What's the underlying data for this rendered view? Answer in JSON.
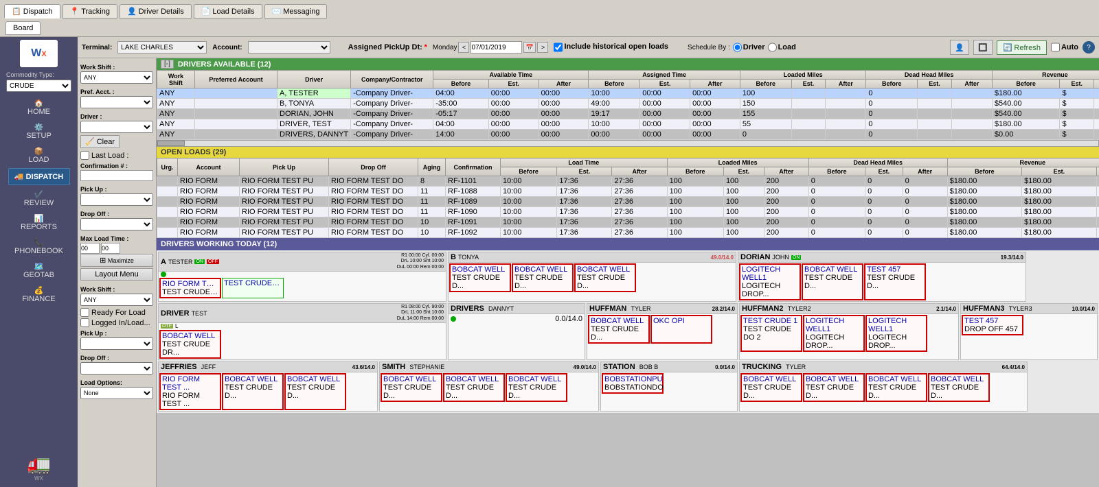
{
  "app": {
    "logo": "WX",
    "commodity_label": "Commodity Type:",
    "commodity_value": "CRUDE"
  },
  "tabs": [
    {
      "label": "Dispatch",
      "icon": "📋",
      "active": true
    },
    {
      "label": "Tracking",
      "icon": "📍",
      "active": false
    },
    {
      "label": "Driver Details",
      "icon": "👤",
      "active": false
    },
    {
      "label": "Load Details",
      "icon": "📄",
      "active": false
    },
    {
      "label": "Messaging",
      "icon": "✉️",
      "active": false
    }
  ],
  "board_tab": {
    "label": "Board",
    "active": true
  },
  "toolbar": {
    "terminal_label": "Terminal:",
    "terminal_value": "LAKE CHARLES",
    "account_label": "Account:",
    "assigned_pickup_label": "Assigned PickUp Dt:",
    "day_label": "Monday",
    "date_value": "07/01/2019",
    "include_historical": "Include historical open loads",
    "schedule_by_label": "Schedule By :",
    "schedule_driver": "Driver",
    "schedule_load": "Load",
    "refresh_label": "Refresh",
    "auto_label": "Auto"
  },
  "filter": {
    "work_shift_label": "Work Shift :",
    "work_shift_value": "ANY",
    "pref_acct_label": "Pref. Acct. :",
    "driver_label": "Driver :",
    "clear_label": "Clear",
    "last_load_label": "Last Load :",
    "confirmation_label": "Confirmation # :",
    "pickup_label": "Pick Up :",
    "dropoff_label": "Drop Off :",
    "max_load_label": "Max Load Time :",
    "max_load_value": "00 : 00",
    "ready_load_label": "Ready For Load",
    "logged_label": "Logged In/Load...",
    "pickup2_label": "Pick Up :",
    "dropoff2_label": "Drop Off :",
    "load_options_label": "Load Options:",
    "load_options_value": "None",
    "maximize_label": "⊞ Maximize",
    "layout_label": "Layout Menu",
    "work_shift2_label": "Work Shift :",
    "work_shift2_value": "ANY"
  },
  "drivers_available": {
    "header": "DRIVERS AVAILABLE (12)",
    "toggle": "[-]",
    "columns": {
      "work_shift": "Work Shift",
      "preferred_account": "Preferred Account",
      "driver": "Driver",
      "company": "Company/Contractor",
      "available_time": "Available Time",
      "assigned_time": "Assigned Time",
      "loaded_miles": "Loaded Miles",
      "dead_head": "Dead Head Miles",
      "revenue": "Revenue"
    },
    "sub_columns": [
      "Before",
      "Est.",
      "After",
      "Before",
      "Est.",
      "After",
      "Before",
      "Est.",
      "After",
      "Before",
      "Est.",
      "After",
      "Before",
      "Est.",
      "Af"
    ],
    "rows": [
      {
        "shift": "ANY",
        "pref_acct": "",
        "driver": "A, TESTER",
        "company": "-Company Driver-",
        "av_before": "04:00",
        "av_est": "00:00",
        "av_after": "00:00",
        "as_before": "10:00",
        "as_est": "00:00",
        "as_after": "00:00",
        "lm_before": "100",
        "lm_est": "",
        "lm_after": "",
        "dh_before": "0",
        "dh_est": "",
        "dh_after": "",
        "rev_before": "$180.00",
        "rev_est": "$",
        "selected": true
      },
      {
        "shift": "ANY",
        "pref_acct": "",
        "driver": "B, TONYA",
        "company": "-Company Driver-",
        "av_before": "-35:00",
        "av_est": "00:00",
        "av_after": "00:00",
        "as_before": "49:00",
        "as_est": "00:00",
        "as_after": "00:00",
        "lm_before": "150",
        "lm_est": "",
        "lm_after": "",
        "dh_before": "0",
        "dh_est": "",
        "dh_after": "",
        "rev_before": "$540.00",
        "rev_est": "$",
        "selected": false
      },
      {
        "shift": "ANY",
        "pref_acct": "",
        "driver": "DORIAN, JOHN",
        "company": "-Company Driver-",
        "av_before": "-05:17",
        "av_est": "00:00",
        "av_after": "00:00",
        "as_before": "19:17",
        "as_est": "00:00",
        "as_after": "00:00",
        "lm_before": "155",
        "lm_est": "",
        "lm_after": "",
        "dh_before": "0",
        "dh_est": "",
        "dh_after": "",
        "rev_before": "$540.00",
        "rev_est": "$",
        "selected": false
      },
      {
        "shift": "ANY",
        "pref_acct": "",
        "driver": "DRIVER, TEST",
        "company": "-Company Driver-",
        "av_before": "04:00",
        "av_est": "00:00",
        "av_after": "00:00",
        "as_before": "10:00",
        "as_est": "00:00",
        "as_after": "00:00",
        "lm_before": "55",
        "lm_est": "",
        "lm_after": "",
        "dh_before": "0",
        "dh_est": "",
        "dh_after": "",
        "rev_before": "$180.00",
        "rev_est": "$",
        "selected": false
      },
      {
        "shift": "ANY",
        "pref_acct": "",
        "driver": "DRIVERS, DANNYT",
        "company": "-Company Driver-",
        "av_before": "14:00",
        "av_est": "00:00",
        "av_after": "00:00",
        "as_before": "00:00",
        "as_est": "00:00",
        "as_after": "00:00",
        "lm_before": "0",
        "lm_est": "",
        "lm_after": "",
        "dh_before": "0",
        "dh_est": "",
        "dh_after": "",
        "rev_before": "$0.00",
        "rev_est": "$",
        "selected": false
      }
    ]
  },
  "open_loads": {
    "header": "OPEN LOADS (29)",
    "columns": {
      "urg": "Urg.",
      "account": "Account",
      "pickup": "Pick Up",
      "dropoff": "Drop Off",
      "aging": "Aging",
      "confirmation": "Confirmation",
      "load_time": "Load Time",
      "loaded_miles": "Loaded Miles",
      "dead_head": "Dead Head Miles",
      "revenue": "Revenue"
    },
    "sub_columns": [
      "Before",
      "Est.",
      "After",
      "Before",
      "Est.",
      "After",
      "Before",
      "Est.",
      "After",
      "Before",
      "Est.",
      "A"
    ],
    "rows": [
      {
        "urg": "",
        "account": "RIO FORM",
        "pickup": "RIO FORM TEST PU",
        "dropoff": "RIO FORM TEST DO",
        "aging": "8",
        "confirmation": "RF-1101",
        "lt_before": "10:00",
        "lt_est": "17:36",
        "lt_after": "27:36",
        "lm_before": "100",
        "lm_est": "100",
        "lm_after": "200",
        "dh_before": "0",
        "dh_est": "0",
        "dh_after": "0",
        "rev_before": "$180.00",
        "rev_est": "$180.00"
      },
      {
        "urg": "",
        "account": "RIO FORM",
        "pickup": "RIO FORM TEST PU",
        "dropoff": "RIO FORM TEST DO",
        "aging": "11",
        "confirmation": "RF-1088",
        "lt_before": "10:00",
        "lt_est": "17:36",
        "lt_after": "27:36",
        "lm_before": "100",
        "lm_est": "100",
        "lm_after": "200",
        "dh_before": "0",
        "dh_est": "0",
        "dh_after": "0",
        "rev_before": "$180.00",
        "rev_est": "$180.00"
      },
      {
        "urg": "",
        "account": "RIO FORM",
        "pickup": "RIO FORM TEST PU",
        "dropoff": "RIO FORM TEST DO",
        "aging": "11",
        "confirmation": "RF-1089",
        "lt_before": "10:00",
        "lt_est": "17:36",
        "lt_after": "27:36",
        "lm_before": "100",
        "lm_est": "100",
        "lm_after": "200",
        "dh_before": "0",
        "dh_est": "0",
        "dh_after": "0",
        "rev_before": "$180.00",
        "rev_est": "$180.00"
      },
      {
        "urg": "",
        "account": "RIO FORM",
        "pickup": "RIO FORM TEST PU",
        "dropoff": "RIO FORM TEST DO",
        "aging": "11",
        "confirmation": "RF-1090",
        "lt_before": "10:00",
        "lt_est": "17:36",
        "lt_after": "27:36",
        "lm_before": "100",
        "lm_est": "100",
        "lm_after": "200",
        "dh_before": "0",
        "dh_est": "0",
        "dh_after": "0",
        "rev_before": "$180.00",
        "rev_est": "$180.00"
      },
      {
        "urg": "",
        "account": "RIO FORM",
        "pickup": "RIO FORM TEST PU",
        "dropoff": "RIO FORM TEST DO",
        "aging": "10",
        "confirmation": "RF-1091",
        "lt_before": "10:00",
        "lt_est": "17:36",
        "lt_after": "27:36",
        "lm_before": "100",
        "lm_est": "100",
        "lm_after": "200",
        "dh_before": "0",
        "dh_est": "0",
        "dh_after": "0",
        "rev_before": "$180.00",
        "rev_est": "$180.00"
      },
      {
        "urg": "",
        "account": "RIO FORM",
        "pickup": "RIO FORM TEST PU",
        "dropoff": "RIO FORM TEST DO",
        "aging": "10",
        "confirmation": "RF-1092",
        "lt_before": "10:00",
        "lt_est": "17:36",
        "lt_after": "27:36",
        "lm_before": "100",
        "lm_est": "100",
        "lm_after": "200",
        "dh_before": "0",
        "dh_est": "0",
        "dh_after": "0",
        "rev_before": "$180.00",
        "rev_est": "$180.00"
      }
    ]
  },
  "drivers_working": {
    "header": "DRIVERS WORKING TODAY (12)",
    "drivers": [
      {
        "id": "A",
        "name": "TESTER",
        "status": "green",
        "badge_on": "ON",
        "badge_off": "OFF",
        "info": "R1  00:00 Cyl. 00:00\nDrL 10:00 Sht 10:00\nDuL 00:00 Rem 00:00",
        "miles": "",
        "loads": [
          {
            "title": "RIO FORM TEST ...",
            "sub": "TEST CRUDE DR...",
            "color": "red"
          },
          {
            "title": "TEST CRUDE DR...",
            "sub": "",
            "color": "green"
          }
        ]
      },
      {
        "id": "B",
        "name": "TONYA",
        "status": "yellow",
        "badge_on": "",
        "badge_off": "",
        "info": "49.0/14.0",
        "miles": "49.0/14.0",
        "loads": [
          {
            "title": "BOBCAT WELL TEST CRUDE D...",
            "sub": "",
            "color": "red"
          },
          {
            "title": "BOBCAT WELL TEST CRUDE D...",
            "sub": "",
            "color": "red"
          },
          {
            "title": "BOBCAT WELL TEST CRUDE D...",
            "sub": "",
            "color": "red"
          }
        ]
      },
      {
        "id": "DORIAN",
        "name": "JOHN",
        "status": "green",
        "info": "",
        "miles": "19.3/14.0",
        "loads": [
          {
            "title": "LOGITECH WELL1",
            "sub": "LOGITECH DROP...",
            "color": "red"
          },
          {
            "title": "BOBCAT WELL",
            "sub": "TEST CRUDE D...",
            "color": "red"
          },
          {
            "title": "TEST 457",
            "sub": "TEST CRUDE D...",
            "color": "red"
          }
        ]
      },
      {
        "id": "DRIVER",
        "name": "TEST",
        "status": "green",
        "info": "R1  08:00 Cyl. 90:00\nDrL 11:00 Sht 10:00\nDuL 14:00 Rem 00:00",
        "miles": "",
        "loads": [
          {
            "title": "BOBCAT WELL TEST CRUDE D...",
            "sub": "",
            "color": "red"
          }
        ]
      },
      {
        "id": "DRIVERS",
        "name": "DANNYT",
        "status": "green",
        "info": "",
        "miles": "0.0/14.0",
        "loads": []
      },
      {
        "id": "HUFFMAN",
        "name": "TYLER",
        "status": "green",
        "info": "",
        "miles": "28.2/14.0",
        "loads": [
          {
            "title": "BOBCAT WELL TEST CRUDE D...",
            "sub": "",
            "color": "red"
          },
          {
            "title": "OKC OPI",
            "sub": "",
            "color": "red"
          }
        ]
      },
      {
        "id": "HUFFMAN2",
        "name": "TYLER2",
        "status": "green",
        "info": "",
        "miles": "2.1/14.0",
        "loads": [
          {
            "title": "TEST CRUDE 1",
            "sub": "TEST CRUDE DO 2",
            "color": "red"
          },
          {
            "title": "LOGITECH WELL1",
            "sub": "LOGITECH DROP...",
            "color": "red"
          },
          {
            "title": "LOGITECH WELL1",
            "sub": "LOGITECH DROP...",
            "color": "red"
          }
        ]
      },
      {
        "id": "HUFFMAN3",
        "name": "TYLER3",
        "status": "green",
        "info": "",
        "miles": "10.0/14.0",
        "loads": [
          {
            "title": "TEST 457",
            "sub": "DROP OFF 457",
            "color": "red"
          }
        ]
      },
      {
        "id": "JEFFRIES",
        "name": "JEFF",
        "status": "green",
        "info": "",
        "miles": "43.6/14.0",
        "loads": [
          {
            "title": "RIO FORM TEST ...",
            "sub": "RIO FORM TEST ...",
            "color": "red"
          },
          {
            "title": "BOBCAT WELL TEST CRUDE D...",
            "sub": "",
            "color": "red"
          },
          {
            "title": "BOBCAT WELL TEST CRUDE D...",
            "sub": "",
            "color": "red"
          }
        ]
      },
      {
        "id": "SMITH",
        "name": "STEPHANIE",
        "status": "green",
        "info": "",
        "miles": "49.0/14.0",
        "loads": [
          {
            "title": "BOBCAT WELL TEST CRUDE D...",
            "sub": "",
            "color": "red"
          },
          {
            "title": "BOBCAT WELL TEST CRUDE D...",
            "sub": "",
            "color": "red"
          },
          {
            "title": "BOBCAT WELL TEST CRUDE D...",
            "sub": "",
            "color": "red"
          }
        ]
      },
      {
        "id": "STATION",
        "name": "BOB B",
        "status": "green",
        "info": "",
        "miles": "0.0/14.0",
        "loads": [
          {
            "title": "BOBSTATIONPU",
            "sub": "BOBSTATIONDO",
            "color": "red"
          }
        ]
      },
      {
        "id": "TRUCKING",
        "name": "TYLER",
        "status": "green",
        "info": "",
        "miles": "64.4/14.0",
        "loads": [
          {
            "title": "BOBCAT WELL TEST CRUDE D...",
            "sub": "",
            "color": "red"
          },
          {
            "title": "BOBCAT WELL TEST CRUDE D...",
            "sub": "",
            "color": "red"
          },
          {
            "title": "BOBCAT WELL TEST CRUDE D...",
            "sub": "",
            "color": "red"
          },
          {
            "title": "BOBCAT WELL TEST CRUDE D...",
            "sub": "",
            "color": "red"
          }
        ]
      }
    ]
  },
  "sidebar_nav": [
    {
      "id": "home",
      "label": "HOME",
      "icon": "🏠"
    },
    {
      "id": "setup",
      "label": "SETUP",
      "icon": "⚙️"
    },
    {
      "id": "load",
      "label": "LOAD",
      "icon": "📦"
    },
    {
      "id": "dispatch",
      "label": "DISPATCH",
      "icon": "🚚"
    },
    {
      "id": "review",
      "label": "REVIEW",
      "icon": "✔️"
    },
    {
      "id": "reports",
      "label": "REPORTS",
      "icon": "📊"
    },
    {
      "id": "phonebook",
      "label": "PHONEBOOK",
      "icon": "📞"
    },
    {
      "id": "geotab",
      "label": "GEOTAB",
      "icon": "🗺️"
    },
    {
      "id": "finance",
      "label": "FINANCE",
      "icon": "💰"
    }
  ],
  "colors": {
    "header_green": "#4a9a4a",
    "header_yellow": "#d4c020",
    "header_blue": "#4a4a8a",
    "sidebar_bg": "#4a4a6a",
    "selected_row": "#b8d4ff"
  }
}
